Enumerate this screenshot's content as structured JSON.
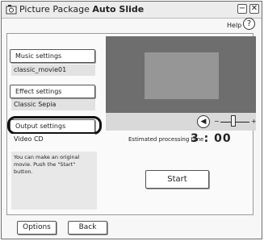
{
  "window": {
    "title_prefix": "Picture Package ",
    "title_bold": "Auto Slide",
    "minimize_symbol": "−",
    "close_symbol": "✕"
  },
  "header": {
    "help_label": "Help",
    "help_symbol": "?"
  },
  "settings": {
    "music": {
      "label": "Music settings",
      "value": "classic_movie01"
    },
    "effect": {
      "label": "Effect settings",
      "value": "Classic Sepia"
    },
    "output": {
      "label": "Output settings",
      "value": "Video CD"
    }
  },
  "info_text": "You can make an original movie. Push the \"Start\" button.",
  "player": {
    "minus": "−",
    "plus": "+",
    "volume_level": 0.45
  },
  "estimate": {
    "label": "Estimated processing time",
    "value": "3 : 00"
  },
  "start_label": "Start",
  "footer": {
    "options_label": "Options",
    "back_label": "Back"
  }
}
